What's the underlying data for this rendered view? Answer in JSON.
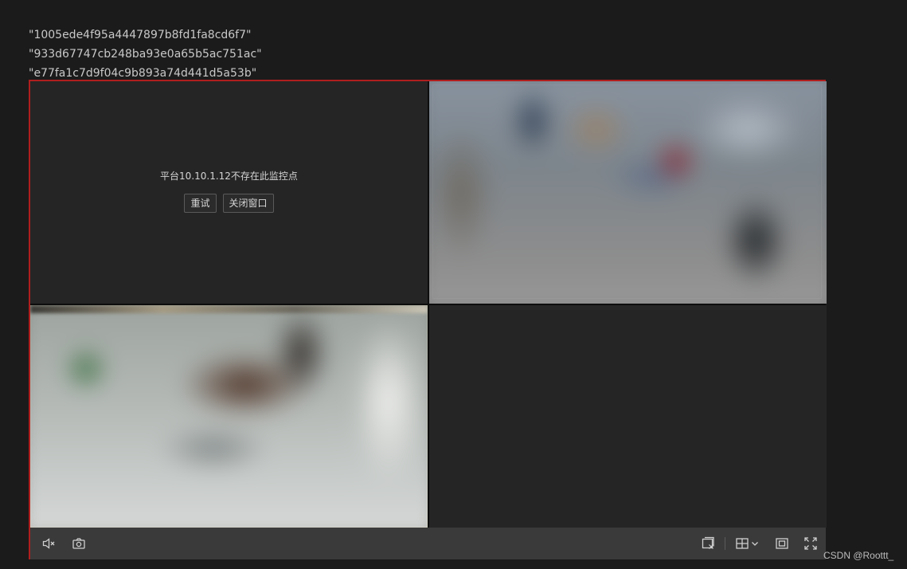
{
  "ids": [
    "\"1005ede4f95a4447897b8fd1fa8cd6f7\"",
    "\"933d67747cb248ba93e0a65b5ac751ac\"",
    "\"e77fa1c7d9f04c9b893a74d441d5a53b\""
  ],
  "player": {
    "error": {
      "message": "平台10.10.1.12不存在此监控点",
      "retry_label": "重试",
      "close_label": "关闭窗口"
    }
  },
  "watermark": "CSDN @Roottt_",
  "colors": {
    "player_border": "#b01e1e",
    "active_cell": "#c9a43a",
    "toolbar_bg": "#3a3a3a"
  },
  "toolbar": {
    "left_icons": [
      "mute-icon",
      "snapshot-icon"
    ],
    "right_icons": [
      "close-all-windows-icon",
      "layout-grid-icon",
      "fit-screen-icon",
      "fullscreen-icon"
    ]
  }
}
